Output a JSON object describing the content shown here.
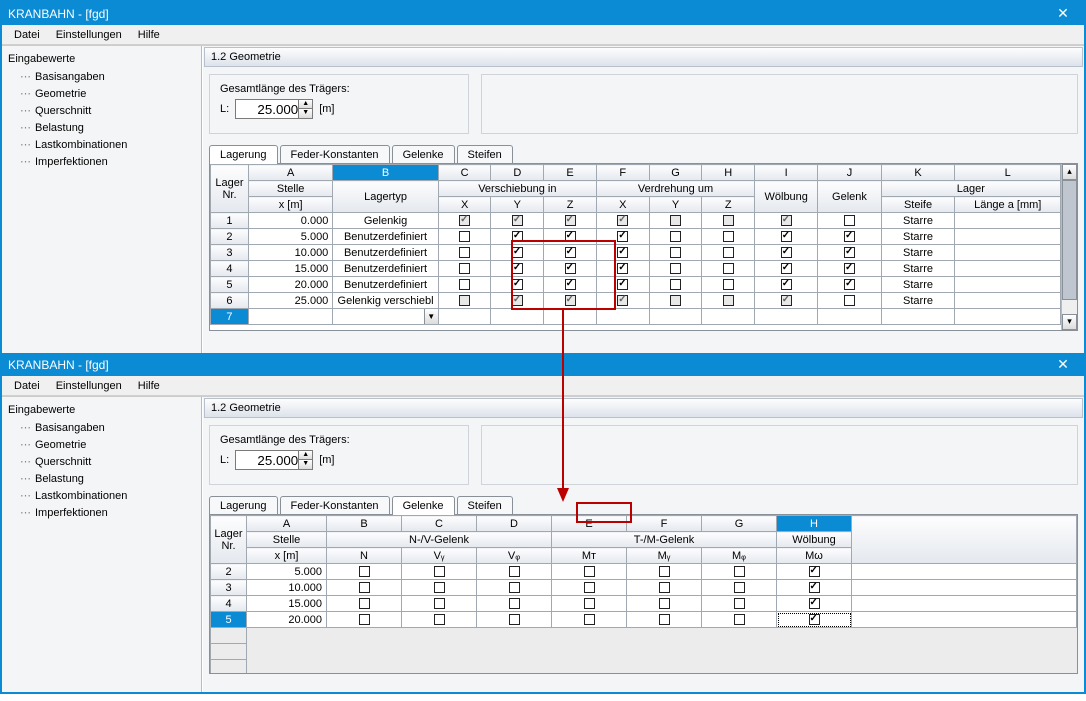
{
  "windowTitle": "KRANBAHN - [fgd]",
  "menu": {
    "datei": "Datei",
    "einstellungen": "Einstellungen",
    "hilfe": "Hilfe"
  },
  "nav": {
    "header": "Eingabewerte",
    "items": [
      "Basisangaben",
      "Geometrie",
      "Querschnitt",
      "Belastung",
      "Lastkombinationen",
      "Imperfektionen"
    ]
  },
  "sectionTitle": "1.2 Geometrie",
  "form": {
    "label": "Gesamtlänge des Trägers:",
    "l_label": "L:",
    "l_value": "25.000",
    "l_unit": "[m]"
  },
  "tabsTop": {
    "t0": "Lagerung",
    "t1": "Feder-Konstanten",
    "t2": "Gelenke",
    "t3": "Steifen"
  },
  "headersTop": {
    "lager": "Lager",
    "nr": "Nr.",
    "stelle": "Stelle",
    "x": "x [m]",
    "lagertyp": "Lagertyp",
    "verschiebung": "Verschiebung in",
    "verdrehung": "Verdrehung um",
    "X": "X",
    "Y": "Y",
    "Z": "Z",
    "woelbung": "Wölbung",
    "gelenk": "Gelenk",
    "steife": "Steife",
    "laenge": "Länge a [mm]",
    "cols": {
      "A": "A",
      "B": "B",
      "C": "C",
      "D": "D",
      "E": "E",
      "F": "F",
      "G": "G",
      "H": "H",
      "I": "I",
      "J": "J",
      "K": "K",
      "L": "L"
    }
  },
  "rowsTop": [
    {
      "nr": "1",
      "x": "0.000",
      "typ": "Gelenkig",
      "cx": "g1",
      "cy": "g1",
      "cz": "g1",
      "rx": "g1",
      "ry": "g0",
      "rz": "g0",
      "w": "g1",
      "g": "b0",
      "s": "Starre",
      "l": ""
    },
    {
      "nr": "2",
      "x": "5.000",
      "typ": "Benutzerdefiniert",
      "cx": "b0",
      "cy": "b1",
      "cz": "b1",
      "rx": "b1",
      "ry": "b0",
      "rz": "b0",
      "w": "b1",
      "g": "b1",
      "s": "Starre",
      "l": ""
    },
    {
      "nr": "3",
      "x": "10.000",
      "typ": "Benutzerdefiniert",
      "cx": "b0",
      "cy": "b1",
      "cz": "b1",
      "rx": "b1",
      "ry": "b0",
      "rz": "b0",
      "w": "b1",
      "g": "b1",
      "s": "Starre",
      "l": ""
    },
    {
      "nr": "4",
      "x": "15.000",
      "typ": "Benutzerdefiniert",
      "cx": "b0",
      "cy": "b1",
      "cz": "b1",
      "rx": "b1",
      "ry": "b0",
      "rz": "b0",
      "w": "b1",
      "g": "b1",
      "s": "Starre",
      "l": ""
    },
    {
      "nr": "5",
      "x": "20.000",
      "typ": "Benutzerdefiniert",
      "cx": "b0",
      "cy": "b1",
      "cz": "b1",
      "rx": "b1",
      "ry": "b0",
      "rz": "b0",
      "w": "b1",
      "g": "b1",
      "s": "Starre",
      "l": ""
    },
    {
      "nr": "6",
      "x": "25.000",
      "typ": "Gelenkig verschiebl",
      "cx": "g0",
      "cy": "g1",
      "cz": "g1",
      "rx": "g1",
      "ry": "g0",
      "rz": "g0",
      "w": "g1",
      "g": "b0",
      "s": "Starre",
      "l": ""
    }
  ],
  "row7": {
    "nr": "7"
  },
  "headersBot": {
    "cols": {
      "A": "A",
      "B": "B",
      "C": "C",
      "D": "D",
      "E": "E",
      "F": "F",
      "G": "G",
      "H": "H"
    },
    "lager": "Lager",
    "nr": "Nr.",
    "stelle": "Stelle",
    "x": "x [m]",
    "nv": "N-/V-Gelenk",
    "tm": "T-/M-Gelenk",
    "woelbung": "Wölbung",
    "N": "N",
    "Vy": "Vᵧ",
    "Vz": "Vᵩ",
    "Mt": "Mᴛ",
    "My": "Mᵧ",
    "Mz": "Mᵩ",
    "Mw": "Mω"
  },
  "rowsBot": [
    {
      "nr": "2",
      "x": "5.000",
      "n": "b0",
      "vy": "b0",
      "vz": "b0",
      "mt": "b0",
      "my": "b0",
      "mz": "b0",
      "mw": "b1"
    },
    {
      "nr": "3",
      "x": "10.000",
      "n": "b0",
      "vy": "b0",
      "vz": "b0",
      "mt": "b0",
      "my": "b0",
      "mz": "b0",
      "mw": "b1"
    },
    {
      "nr": "4",
      "x": "15.000",
      "n": "b0",
      "vy": "b0",
      "vz": "b0",
      "mt": "b0",
      "my": "b0",
      "mz": "b0",
      "mw": "b1"
    },
    {
      "nr": "5",
      "x": "20.000",
      "n": "b0",
      "vy": "b0",
      "vz": "b0",
      "mt": "b0",
      "my": "b0",
      "mz": "b0",
      "mw": "b1"
    }
  ]
}
